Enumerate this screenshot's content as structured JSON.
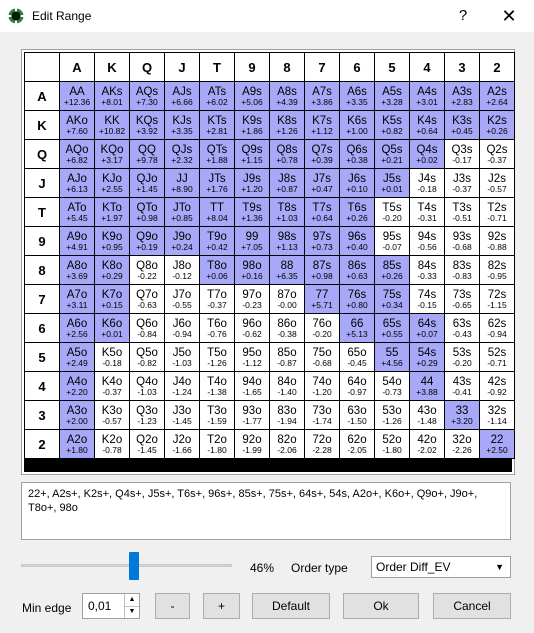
{
  "window": {
    "title": "Edit Range",
    "help": "?",
    "close": "✕"
  },
  "grid": {
    "headers": [
      "A",
      "K",
      "Q",
      "J",
      "T",
      "9",
      "8",
      "7",
      "6",
      "5",
      "4",
      "3",
      "2"
    ],
    "rows": [
      [
        [
          "AA",
          "+12.36",
          1
        ],
        [
          "AKs",
          "+8.01",
          1
        ],
        [
          "AQs",
          "+7.30",
          1
        ],
        [
          "AJs",
          "+6.66",
          1
        ],
        [
          "ATs",
          "+6.02",
          1
        ],
        [
          "A9s",
          "+5.06",
          1
        ],
        [
          "A8s",
          "+4.39",
          1
        ],
        [
          "A7s",
          "+3.86",
          1
        ],
        [
          "A6s",
          "+3.35",
          1
        ],
        [
          "A5s",
          "+3.28",
          1
        ],
        [
          "A4s",
          "+3.01",
          1
        ],
        [
          "A3s",
          "+2.83",
          1
        ],
        [
          "A2s",
          "+2.64",
          1
        ]
      ],
      [
        [
          "AKo",
          "+7.60",
          1
        ],
        [
          "KK",
          "+10.82",
          1
        ],
        [
          "KQs",
          "+3.92",
          1
        ],
        [
          "KJs",
          "+3.35",
          1
        ],
        [
          "KTs",
          "+2.81",
          1
        ],
        [
          "K9s",
          "+1.86",
          1
        ],
        [
          "K8s",
          "+1.26",
          1
        ],
        [
          "K7s",
          "+1.12",
          1
        ],
        [
          "K6s",
          "+1.00",
          1
        ],
        [
          "K5s",
          "+0.82",
          1
        ],
        [
          "K4s",
          "+0.64",
          1
        ],
        [
          "K3s",
          "+0.45",
          1
        ],
        [
          "K2s",
          "+0.26",
          1
        ]
      ],
      [
        [
          "AQo",
          "+6.82",
          1
        ],
        [
          "KQo",
          "+3.17",
          1
        ],
        [
          "QQ",
          "+9.78",
          1
        ],
        [
          "QJs",
          "+2.32",
          1
        ],
        [
          "QTs",
          "+1.88",
          1
        ],
        [
          "Q9s",
          "+1.15",
          1
        ],
        [
          "Q8s",
          "+0.78",
          1
        ],
        [
          "Q7s",
          "+0.39",
          1
        ],
        [
          "Q6s",
          "+0.38",
          1
        ],
        [
          "Q5s",
          "+0.21",
          1
        ],
        [
          "Q4s",
          "+0.02",
          1
        ],
        [
          "Q3s",
          "-0.17",
          0
        ],
        [
          "Q2s",
          "-0.37",
          0
        ]
      ],
      [
        [
          "AJo",
          "+6.13",
          1
        ],
        [
          "KJo",
          "+2.55",
          1
        ],
        [
          "QJo",
          "+1.45",
          1
        ],
        [
          "JJ",
          "+8.90",
          1
        ],
        [
          "JTs",
          "+1.76",
          1
        ],
        [
          "J9s",
          "+1.20",
          1
        ],
        [
          "J8s",
          "+0.87",
          1
        ],
        [
          "J7s",
          "+0.47",
          1
        ],
        [
          "J6s",
          "+0.10",
          1
        ],
        [
          "J5s",
          "+0.01",
          1
        ],
        [
          "J4s",
          "-0.18",
          0
        ],
        [
          "J3s",
          "-0.37",
          0
        ],
        [
          "J2s",
          "-0.57",
          0
        ]
      ],
      [
        [
          "ATo",
          "+5.45",
          1
        ],
        [
          "KTo",
          "+1.97",
          1
        ],
        [
          "QTo",
          "+0.98",
          1
        ],
        [
          "JTo",
          "+0.85",
          1
        ],
        [
          "TT",
          "+8.04",
          1
        ],
        [
          "T9s",
          "+1.36",
          1
        ],
        [
          "T8s",
          "+1.03",
          1
        ],
        [
          "T7s",
          "+0.64",
          1
        ],
        [
          "T6s",
          "+0.26",
          1
        ],
        [
          "T5s",
          "-0.20",
          0
        ],
        [
          "T4s",
          "-0.31",
          0
        ],
        [
          "T3s",
          "-0.51",
          0
        ],
        [
          "T2s",
          "-0.71",
          0
        ]
      ],
      [
        [
          "A9o",
          "+4.91",
          1
        ],
        [
          "K9o",
          "+0.95",
          1
        ],
        [
          "Q9o",
          "+0.19",
          1
        ],
        [
          "J9o",
          "+0.24",
          1
        ],
        [
          "T9o",
          "+0.42",
          1
        ],
        [
          "99",
          "+7.05",
          1
        ],
        [
          "98s",
          "+1.13",
          1
        ],
        [
          "97s",
          "+0.73",
          1
        ],
        [
          "96s",
          "+0.40",
          1
        ],
        [
          "95s",
          "-0.07",
          0
        ],
        [
          "94s",
          "-0.56",
          0
        ],
        [
          "93s",
          "-0.68",
          0
        ],
        [
          "92s",
          "-0.88",
          0
        ]
      ],
      [
        [
          "A8o",
          "+3.69",
          1
        ],
        [
          "K8o",
          "+0.29",
          1
        ],
        [
          "Q8o",
          "-0.22",
          0
        ],
        [
          "J8o",
          "-0.12",
          0
        ],
        [
          "T8o",
          "+0.06",
          1
        ],
        [
          "98o",
          "+0.16",
          1
        ],
        [
          "88",
          "+6.35",
          1
        ],
        [
          "87s",
          "+0.98",
          1
        ],
        [
          "86s",
          "+0.63",
          1
        ],
        [
          "85s",
          "+0.26",
          1
        ],
        [
          "84s",
          "-0.33",
          0
        ],
        [
          "83s",
          "-0.83",
          0
        ],
        [
          "82s",
          "-0.95",
          0
        ]
      ],
      [
        [
          "A7o",
          "+3.11",
          1
        ],
        [
          "K7o",
          "+0.15",
          1
        ],
        [
          "Q7o",
          "-0.63",
          0
        ],
        [
          "J7o",
          "-0.55",
          0
        ],
        [
          "T7o",
          "-0.37",
          0
        ],
        [
          "97o",
          "-0.23",
          0
        ],
        [
          "87o",
          "-0.00",
          0
        ],
        [
          "77",
          "+5.71",
          1
        ],
        [
          "76s",
          "+0.80",
          1
        ],
        [
          "75s",
          "+0.34",
          1
        ],
        [
          "74s",
          "-0.15",
          0
        ],
        [
          "73s",
          "-0.65",
          0
        ],
        [
          "72s",
          "-1.15",
          0
        ]
      ],
      [
        [
          "A6o",
          "+2.56",
          1
        ],
        [
          "K6o",
          "+0.01",
          1
        ],
        [
          "Q6o",
          "-0.84",
          0
        ],
        [
          "J6o",
          "-0.94",
          0
        ],
        [
          "T6o",
          "-0.76",
          0
        ],
        [
          "96o",
          "-0.62",
          0
        ],
        [
          "86o",
          "-0.38",
          0
        ],
        [
          "76o",
          "-0.20",
          0
        ],
        [
          "66",
          "+5.13",
          1
        ],
        [
          "65s",
          "+0.55",
          1
        ],
        [
          "64s",
          "+0.07",
          1
        ],
        [
          "63s",
          "-0.43",
          0
        ],
        [
          "62s",
          "-0.94",
          0
        ]
      ],
      [
        [
          "A5o",
          "+2.49",
          1
        ],
        [
          "K5o",
          "-0.18",
          0
        ],
        [
          "Q5o",
          "-0.82",
          0
        ],
        [
          "J5o",
          "-1.03",
          0
        ],
        [
          "T5o",
          "-1.26",
          0
        ],
        [
          "95o",
          "-1.12",
          0
        ],
        [
          "85o",
          "-0.87",
          0
        ],
        [
          "75o",
          "-0.68",
          0
        ],
        [
          "65o",
          "-0.45",
          0
        ],
        [
          "55",
          "+4.56",
          1
        ],
        [
          "54s",
          "+0.29",
          1
        ],
        [
          "53s",
          "-0.20",
          0
        ],
        [
          "52s",
          "-0.71",
          0
        ]
      ],
      [
        [
          "A4o",
          "+2.20",
          1
        ],
        [
          "K4o",
          "-0.37",
          0
        ],
        [
          "Q4o",
          "-1.03",
          0
        ],
        [
          "J4o",
          "-1.24",
          0
        ],
        [
          "T4o",
          "-1.38",
          0
        ],
        [
          "94o",
          "-1.65",
          0
        ],
        [
          "84o",
          "-1.40",
          0
        ],
        [
          "74o",
          "-1.20",
          0
        ],
        [
          "64o",
          "-0.97",
          0
        ],
        [
          "54o",
          "-0.73",
          0
        ],
        [
          "44",
          "+3.88",
          1
        ],
        [
          "43s",
          "-0.41",
          0
        ],
        [
          "42s",
          "-0.92",
          0
        ]
      ],
      [
        [
          "A3o",
          "+2.00",
          1
        ],
        [
          "K3o",
          "-0.57",
          0
        ],
        [
          "Q3o",
          "-1.23",
          0
        ],
        [
          "J3o",
          "-1.45",
          0
        ],
        [
          "T3o",
          "-1.59",
          0
        ],
        [
          "93o",
          "-1.77",
          0
        ],
        [
          "83o",
          "-1.94",
          0
        ],
        [
          "73o",
          "-1.74",
          0
        ],
        [
          "63o",
          "-1.50",
          0
        ],
        [
          "53o",
          "-1.26",
          0
        ],
        [
          "43o",
          "-1.48",
          0
        ],
        [
          "33",
          "+3.20",
          1
        ],
        [
          "32s",
          "-1.14",
          0
        ]
      ],
      [
        [
          "A2o",
          "+1.80",
          1
        ],
        [
          "K2o",
          "-0.78",
          0
        ],
        [
          "Q2o",
          "-1.45",
          0
        ],
        [
          "J2o",
          "-1.66",
          0
        ],
        [
          "T2o",
          "-1.80",
          0
        ],
        [
          "92o",
          "-1.99",
          0
        ],
        [
          "82o",
          "-2.06",
          0
        ],
        [
          "72o",
          "-2.28",
          0
        ],
        [
          "62o",
          "-2.05",
          0
        ],
        [
          "52o",
          "-1.80",
          0
        ],
        [
          "42o",
          "-2.02",
          0
        ],
        [
          "32o",
          "-2.26",
          0
        ],
        [
          "22",
          "+2.50",
          1
        ]
      ]
    ]
  },
  "range_text": "22+, A2s+, K2s+, Q4s+, J5s+, T6s+, 96s+, 85s+, 75s+, 64s+, 54s, A2o+, K6o+, Q9o+, J9o+, T8o+, 98o",
  "controls": {
    "slider_percent": 46,
    "slider_label": "46%",
    "order_type_label": "Order type",
    "order_type_value": "Order Diff_EV",
    "min_edge_label": "Min edge",
    "min_edge_value": "0,01",
    "minus_label": "-",
    "plus_label": "+",
    "default_label": "Default",
    "ok_label": "Ok",
    "cancel_label": "Cancel"
  },
  "colors": {
    "selected": "#a8a8f8",
    "unselected": "#ffffff",
    "slider": "#0078d7"
  }
}
